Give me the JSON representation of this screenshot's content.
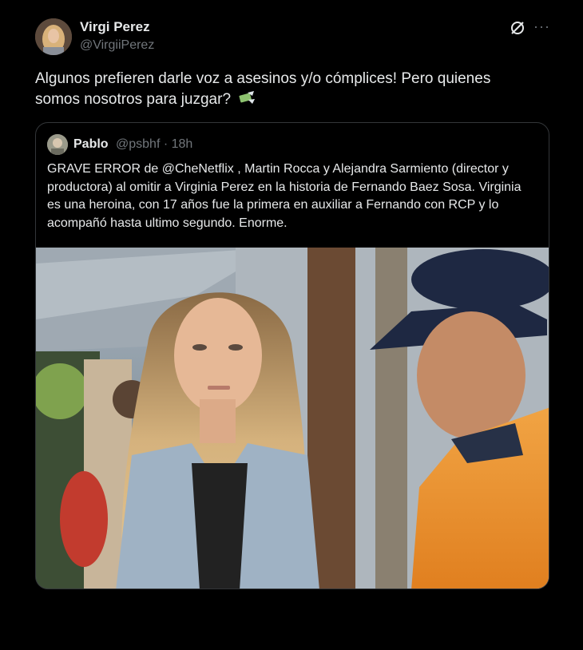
{
  "author": {
    "name": "Virgi Perez",
    "handle": "@VirgiiPerez"
  },
  "header_icons": [
    "grok-icon",
    "more-icon"
  ],
  "tweet": {
    "text": "Algunos prefieren darle voz a asesinos y/o cómplices! Pero quienes somos nosotros para juzgar?",
    "emoji": "money-with-wings-icon"
  },
  "quoted": {
    "name": "Pablo",
    "meta": "@psbhf · 18h",
    "text": "GRAVE ERROR de @CheNetflix , Martin Rocca y Alejandra Sarmiento (director y productora) al omitir a Virginia Perez en la historia de Fernando Baez Sosa. Virginia es una heroina, con 17 años fue la primera en auxiliar a Fernando con RCP y lo acompañó hasta ultimo segundo. Enorme."
  },
  "colors": {
    "background": "#000000",
    "text": "#e7e9ea",
    "muted": "#71767b",
    "border": "#333639"
  }
}
